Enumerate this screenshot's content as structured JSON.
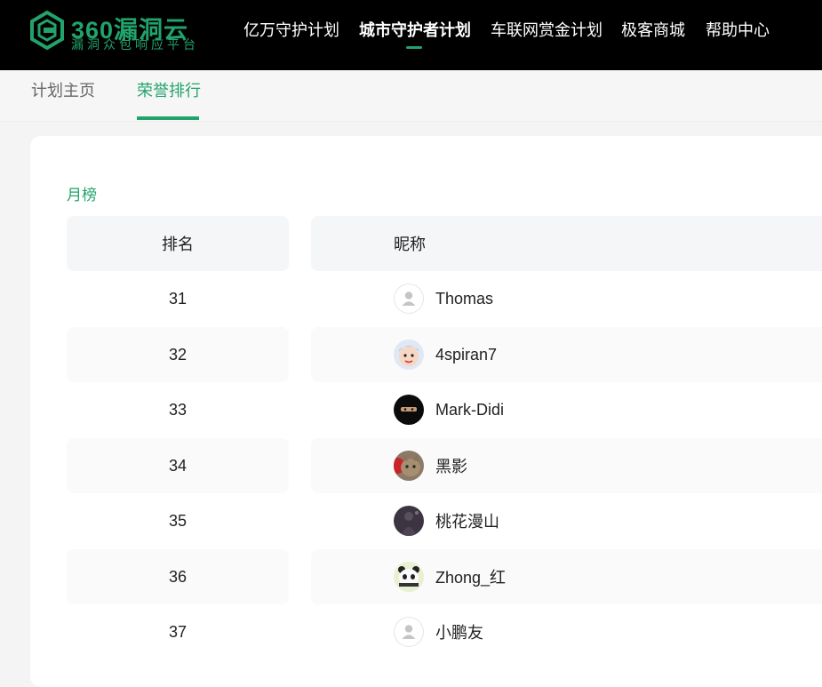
{
  "header": {
    "logo": {
      "brand": "360漏洞云",
      "sub": "漏洞众包响应平台"
    },
    "nav": [
      {
        "label": "亿万守护计划",
        "active": false
      },
      {
        "label": "城市守护者计划",
        "active": true
      },
      {
        "label": "车联网赏金计划",
        "active": false
      },
      {
        "label": "极客商城",
        "active": false
      },
      {
        "label": "帮助中心",
        "active": false
      }
    ]
  },
  "subnav": {
    "tabs": [
      {
        "label": "计划主页",
        "active": false
      },
      {
        "label": "荣誉排行",
        "active": true
      }
    ]
  },
  "ranking": {
    "title": "月榜",
    "columns": {
      "rank": "排名",
      "nickname": "昵称"
    },
    "rows": [
      {
        "rank": "31",
        "nickname": "Thomas",
        "avatar": "default-avatar-icon"
      },
      {
        "rank": "32",
        "nickname": "4spiran7",
        "avatar": "cartoon-boy-avatar"
      },
      {
        "rank": "33",
        "nickname": "Mark-Didi",
        "avatar": "masked-ninja-avatar"
      },
      {
        "rank": "34",
        "nickname": "黑影",
        "avatar": "cat-photo-avatar"
      },
      {
        "rank": "35",
        "nickname": "桃花漫山",
        "avatar": "dark-figure-avatar"
      },
      {
        "rank": "36",
        "nickname": "Zhong_红",
        "avatar": "panda-avatar"
      },
      {
        "rank": "37",
        "nickname": "小鹏友",
        "avatar": "default-avatar-icon"
      }
    ]
  },
  "colors": {
    "accent": "#21a36b",
    "topbar": "#000000",
    "header_cell": "#f5f6f8"
  }
}
